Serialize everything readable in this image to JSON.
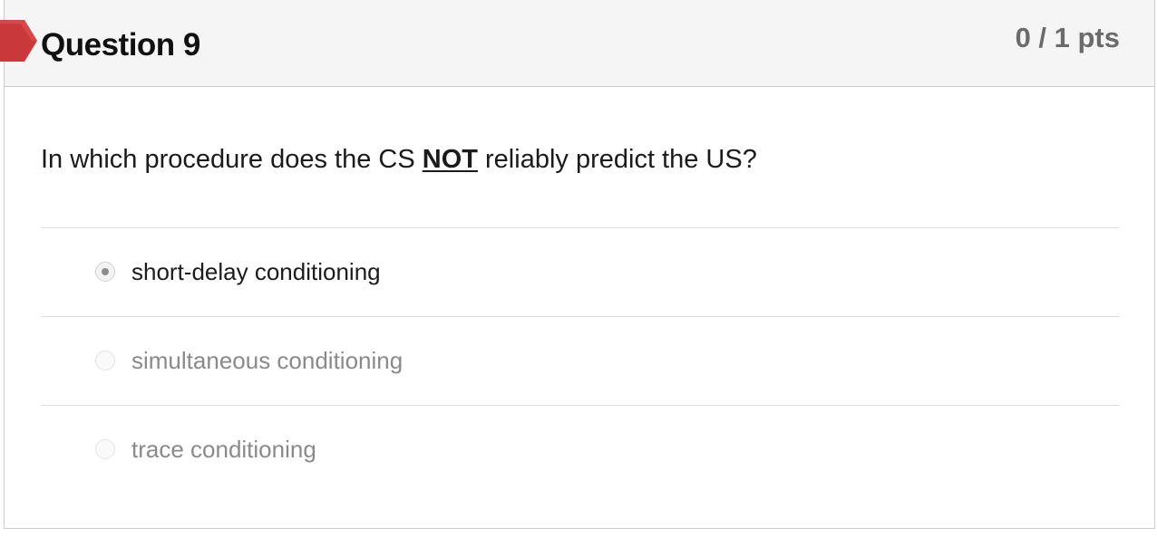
{
  "question": {
    "title": "Question 9",
    "points": "0 / 1 pts",
    "flag_color": "#c9383a",
    "text_before": "In which procedure does the CS ",
    "text_emphasis": "NOT",
    "text_after": " reliably predict the US?"
  },
  "answers": [
    {
      "label": "short-delay conditioning",
      "selected": true
    },
    {
      "label": "simultaneous conditioning",
      "selected": false
    },
    {
      "label": "trace conditioning",
      "selected": false
    }
  ]
}
